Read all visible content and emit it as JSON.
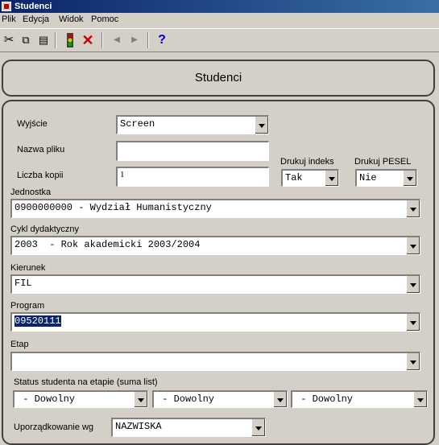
{
  "window": {
    "title": "Studenci"
  },
  "menu": [
    "Plik",
    "Edycja",
    "Widok",
    "Pomoc"
  ],
  "toolbar_icons": [
    "cut-icon",
    "copy-icon",
    "paste-icon",
    "traffic-light-icon",
    "delete-x-icon",
    "previous-icon",
    "next-icon",
    "help-icon"
  ],
  "header": {
    "title": "Studenci"
  },
  "form": {
    "output_label": "Wyjście",
    "output_value": "Screen",
    "filename_label": "Nazwa pliku",
    "filename_value": "",
    "copies_label": "Liczba kopii",
    "copies_value": "1",
    "print_index_label": "Drukuj indeks",
    "print_index_value": "Tak",
    "print_pesel_label": "Drukuj PESEL",
    "print_pesel_value": "Nie",
    "unit_label": "Jednostka",
    "unit_value": "0900000000 - Wydział Humanistyczny",
    "cycle_label": "Cykl dydaktyczny",
    "cycle_value": "2003  - Rok akademicki 2003/2004",
    "direction_label": "Kierunek",
    "direction_value": "FIL",
    "program_label": "Program",
    "program_value": "09520111",
    "stage_label": "Etap",
    "stage_value": "",
    "status_label": "Status studenta na etapie (suma list)",
    "status_values": [
      " - Dowolny",
      " - Dowolny",
      " - Dowolny"
    ],
    "order_label": "Uporządkowanie wg",
    "order_value": "NAZWISKA"
  },
  "colors": {
    "selection": "#0a246a",
    "titlebar": "#0a246a",
    "delete_icon": "#cc0000",
    "help_icon": "#0000cc"
  }
}
